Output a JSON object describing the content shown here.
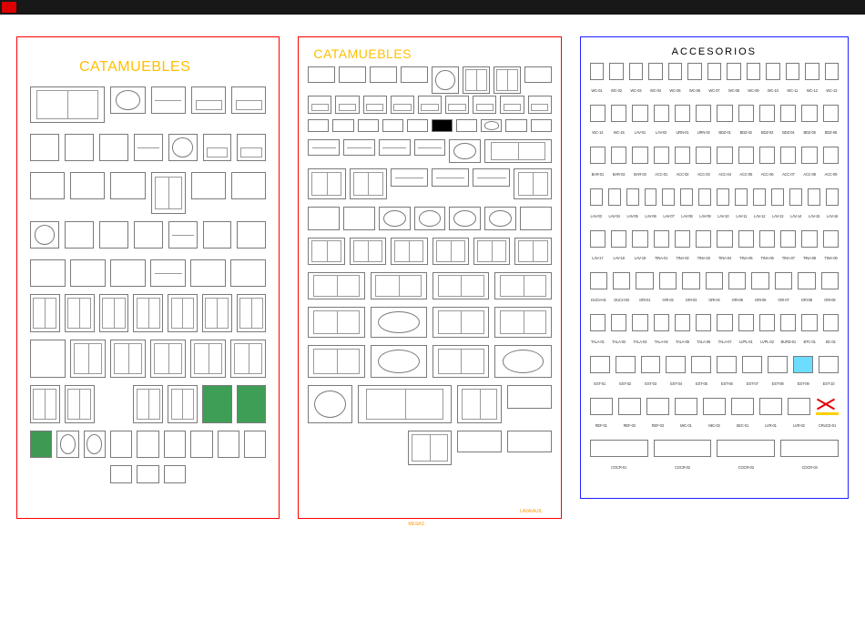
{
  "window": {
    "active_tab_indicator": "red"
  },
  "panels": [
    {
      "id": "catamuebles-iso",
      "title": "CATAMUEBLES",
      "border": "#ff0000",
      "title_color": "#ffbf00",
      "symbols_note": "isometric furniture blocks: L-kitchen, dining tables, desks, armchairs, sofas, beds (single/double), wardrobes, mirrors, piano, decor items; ~60 blocks in loose grid; two beds filled green",
      "symbol_count_approx": 62,
      "highlight_color": "#3e9e55"
    },
    {
      "id": "catamuebles-plan",
      "title": "CATAMUEBLES",
      "border": "#ff0000",
      "title_color": "#ffbf00",
      "bottom_labels": [
        "MESAS",
        "LAVAVAJIL"
      ],
      "symbols_note": "plan-view furniture blocks: chairs, armchairs, round/rect dining sets (4–12 seats), sectional sofas, coffee tables, rugs, L-sofas, conference tables, kitchen range; ~70 blocks",
      "symbol_count_approx": 70,
      "black_block": true
    },
    {
      "id": "accesorios",
      "title": "ACCESORIOS",
      "border": "#2020ff",
      "title_color": "#000000",
      "rows": [
        {
          "labels": [
            "WC-01",
            "WC-02",
            "WC-03",
            "WC-04",
            "WC-05",
            "WC-06",
            "WC-07",
            "WC-08",
            "WC-09",
            "WC-10",
            "WC-11",
            "WC-12",
            "WC-13"
          ]
        },
        {
          "labels": [
            "WC-14",
            "WC-15",
            "LAV-01",
            "LAV-02",
            "URN-01",
            "URN-02",
            "BDZ-01",
            "BDZ-02",
            "BDZ-03",
            "BDZ-04",
            "BDZ-05",
            "BDZ-06"
          ]
        },
        {
          "labels": [
            "BAR-01",
            "BAR-02",
            "BAR-03",
            "ACC-01",
            "ACC-02",
            "ACC-03",
            "ACC-04",
            "ACC-05",
            "ACC-06",
            "ACC-07",
            "ACC-08",
            "ACC-09"
          ]
        },
        {
          "labels": [
            "LAV-03",
            "LAV-04",
            "LAV-05",
            "LAV-06",
            "LAV-07",
            "LAV-08",
            "LAV-09",
            "LAV-10",
            "LAV-11",
            "LAV-12",
            "LAV-13",
            "LAV-14",
            "LAV-15",
            "LAV-16"
          ]
        },
        {
          "labels": [
            "LAV-17",
            "LAV-18",
            "LAV-19",
            "TINA-01",
            "TINA-02",
            "TINA-03",
            "TINA-04",
            "TINA-05",
            "TINA-06",
            "TINA-07",
            "TINA-08",
            "TINA-09"
          ]
        },
        {
          "labels": [
            "DUCH-01",
            "DUCH-02",
            "GRI-01",
            "GRI-02",
            "GRI-03",
            "GRI-04",
            "GRI-05",
            "GRI-06",
            "GRI-07",
            "GRI-08",
            "GRI-09"
          ]
        },
        {
          "labels": [
            "TALA-01",
            "TALA-02",
            "TALA-03",
            "TALA-04",
            "TALA-05",
            "TALA-06",
            "TALA-07",
            "LVPL-01",
            "LVPL-02",
            "BURD-01",
            "BTC-01",
            "BC-01"
          ]
        },
        {
          "labels": [
            "EST-01",
            "EST-02",
            "EST-03",
            "EST-04",
            "EST-05",
            "EST-06",
            "EST-07",
            "EST-08",
            "EST-09",
            "EST-10"
          ]
        },
        {
          "labels": [
            "REF-01",
            "REF-02",
            "REF-03",
            "MIC-01",
            "MIC-02",
            "SEC-01",
            "LVR-01",
            "LVR-02",
            "CRUCE-01"
          ]
        },
        {
          "labels": [
            "COCR-01",
            "COCR-02",
            "COCR-03",
            "COCR-04"
          ]
        }
      ],
      "colored": {
        "cyan_item_row": 7,
        "cyan_item_col": 8,
        "rail_cross_row": 8,
        "rail_cross_col": 8
      }
    }
  ]
}
